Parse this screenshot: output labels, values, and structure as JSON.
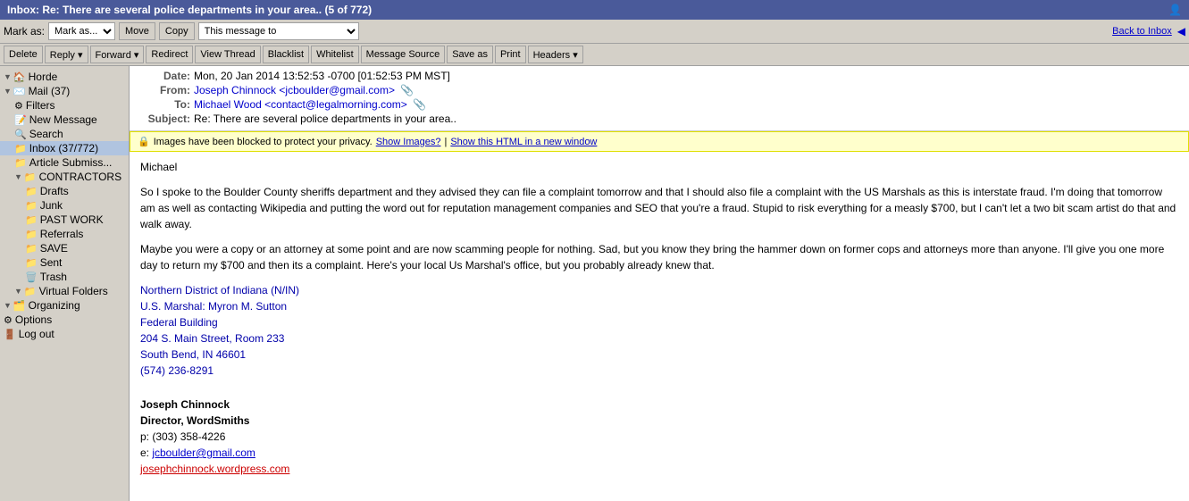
{
  "title_bar": {
    "title": "Inbox: Re: There are several police departments in your area.. (5 of 772)",
    "icon": "📧"
  },
  "toolbar1": {
    "mark_as_label": "Mark as:",
    "move_label": "Move",
    "copy_label": "Copy",
    "message_to_label": "This message to",
    "back_label": "Back to Inbox"
  },
  "toolbar2": {
    "buttons": [
      "Delete",
      "Reply",
      "Forward",
      "Redirect",
      "View Thread",
      "Blacklist",
      "Whitelist",
      "Message Source",
      "Save as",
      "Print",
      "Headers"
    ]
  },
  "sidebar": {
    "items": [
      {
        "label": "Horde",
        "icon": "🏠",
        "indent": 0,
        "expand": true
      },
      {
        "label": "Mail (37)",
        "icon": "✉️",
        "indent": 0,
        "expand": true
      },
      {
        "label": "Filters",
        "icon": "⚙",
        "indent": 1,
        "expand": false
      },
      {
        "label": "New Message",
        "icon": "📝",
        "indent": 1,
        "expand": false
      },
      {
        "label": "Search",
        "icon": "🔍",
        "indent": 1,
        "expand": false
      },
      {
        "label": "Inbox (37/772)",
        "icon": "📁",
        "indent": 1,
        "expand": false,
        "selected": true
      },
      {
        "label": "Article Submiss...",
        "icon": "📁",
        "indent": 1,
        "expand": false
      },
      {
        "label": "CONTRACTORS",
        "icon": "📁",
        "indent": 1,
        "expand": true
      },
      {
        "label": "Drafts",
        "icon": "📁",
        "indent": 2,
        "expand": false
      },
      {
        "label": "Junk",
        "icon": "📁",
        "indent": 2,
        "expand": false
      },
      {
        "label": "PAST WORK",
        "icon": "📁",
        "indent": 2,
        "expand": false
      },
      {
        "label": "Referrals",
        "icon": "📁",
        "indent": 2,
        "expand": false
      },
      {
        "label": "SAVE",
        "icon": "📁",
        "indent": 2,
        "expand": false
      },
      {
        "label": "Sent",
        "icon": "📁",
        "indent": 2,
        "expand": false
      },
      {
        "label": "Trash",
        "icon": "🗑️",
        "indent": 2,
        "expand": false
      },
      {
        "label": "Virtual Folders",
        "icon": "📁",
        "indent": 1,
        "expand": true
      },
      {
        "label": "Organizing",
        "icon": "🗂️",
        "indent": 0,
        "expand": true
      },
      {
        "label": "Options",
        "icon": "⚙",
        "indent": 0,
        "expand": false
      },
      {
        "label": "Log out",
        "icon": "🚪",
        "indent": 0,
        "expand": false
      }
    ]
  },
  "message": {
    "date": "Mon, 20 Jan 2014 13:52:53 -0700 [01:52:53 PM MST]",
    "from": "Joseph Chinnock <jcboulder@gmail.com>",
    "to": "Michael Wood <contact@legalmorning.com>",
    "subject": "Re: There are several police departments in your area..",
    "privacy_notice": "Images have been blocked to protect your privacy.",
    "show_images": "Show Images?",
    "show_html": "Show this HTML in a new window",
    "greeting": "Michael",
    "paragraph1": "So I spoke to the Boulder County sheriffs department and they advised they can file a complaint tomorrow and that I should also file a complaint with the US Marshals as this is interstate fraud. I'm doing that tomorrow am as well as contacting Wikipedia and putting the word out for reputation management companies and SEO that you're a fraud. Stupid to risk everything for a measly $700, but I can't let a two bit scam artist do that and walk away.",
    "paragraph2": "Maybe you were a copy or an attorney at some point and are now scamming people for nothing. Sad, but you know they bring the hammer down on former cops and attorneys more than anyone. I'll give you one more day to return my $700 and then its a complaint. Here's your local Us Marshal's office, but you probably already knew that.",
    "address_title": "Northern District of Indiana (N/IN)",
    "address_line1": "U.S. Marshal: Myron M. Sutton",
    "address_line2": "Federal Building",
    "address_line3": "204 S. Main Street, Room 233",
    "address_line4": "South Bend, IN 46601",
    "address_phone": "(574) 236-8291",
    "sig_name": "Joseph Chinnock",
    "sig_title": "Director, WordSmiths",
    "sig_phone": "p: (303) 358-4226",
    "sig_email": "e: jcboulder@gmail.com",
    "sig_website": "josephchinnock.wordpress.com"
  }
}
